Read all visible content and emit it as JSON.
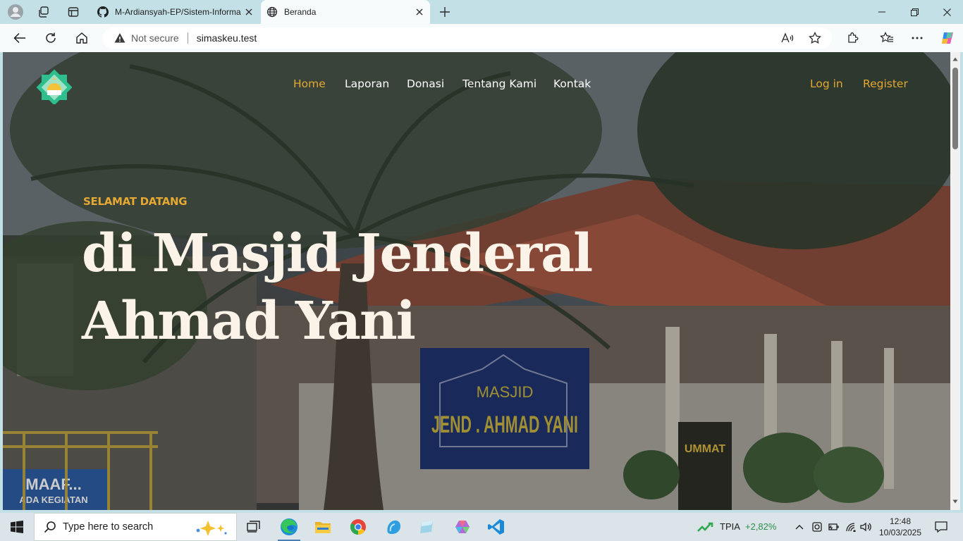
{
  "browser": {
    "tabs": [
      {
        "title": "M-Ardiansyah-EP/Sistem-Informa",
        "icon": "github-icon",
        "active": false
      },
      {
        "title": "Beranda",
        "icon": "globe-icon",
        "active": true
      }
    ],
    "security_label": "Not secure",
    "url": "simaskeu.test"
  },
  "site": {
    "nav": {
      "home": "Home",
      "laporan": "Laporan",
      "donasi": "Donasi",
      "tentang": "Tentang Kami",
      "kontak": "Kontak",
      "login": "Log in",
      "register": "Register"
    },
    "hero": {
      "kicker": "SELAMAT DATANG",
      "title": "di Masjid Jenderal Ahmad Yani"
    },
    "photo_signs": {
      "masjid": "MASJID",
      "name": "JEND . AHMAD YANI",
      "banner_1": "MAAF...",
      "banner_2": "ADA KEGIATAN",
      "poster": "UMMAT"
    },
    "colors": {
      "accent": "#e5a832",
      "hero_text": "#fbf3e8"
    }
  },
  "taskbar": {
    "search_placeholder": "Type here to search",
    "stock_symbol": "TPIA",
    "stock_change": "+2,82%",
    "time": "12:48",
    "date": "10/03/2025"
  }
}
